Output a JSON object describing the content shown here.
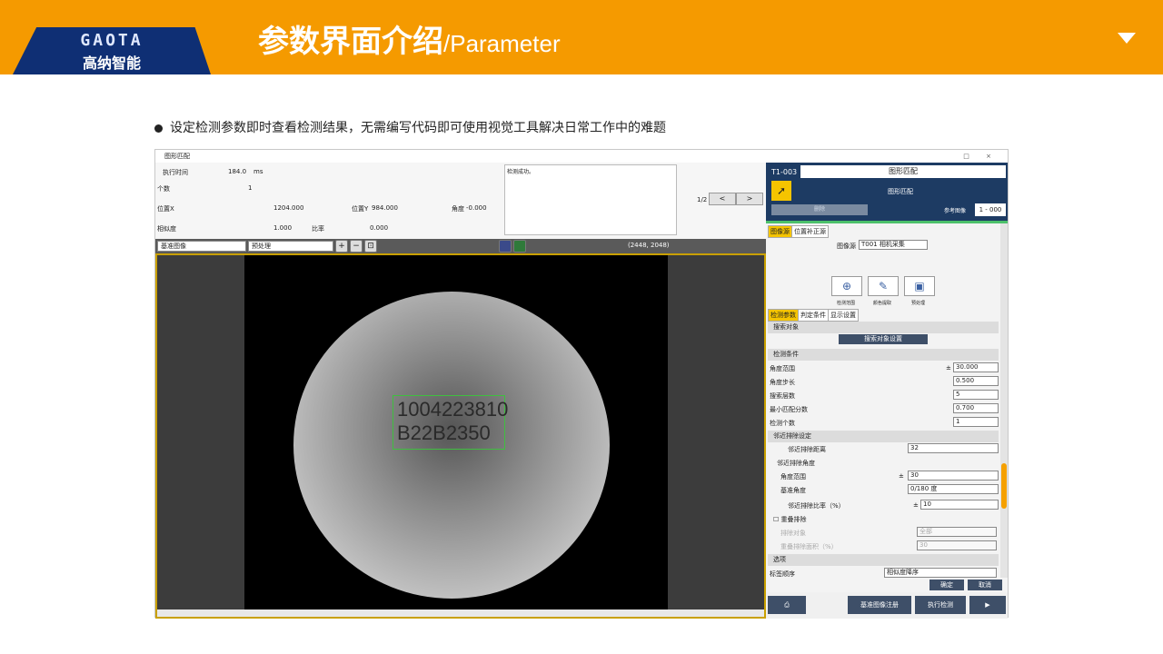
{
  "logo": {
    "en": "GAOTA",
    "cn": "高纳智能"
  },
  "slide": {
    "title_cn": "参数界面介绍",
    "title_en": "/Parameter",
    "bullet": "设定检测参数即时查看检测结果，无需编写代码即可使用视觉工具解决日常工作中的难题"
  },
  "window": {
    "title": "图形匹配",
    "controls": "□ ×"
  },
  "info": {
    "exec_time_label": "执行时间",
    "exec_time_value": "184.0",
    "exec_time_unit": "ms",
    "count_label": "个数",
    "count_value": "1",
    "pos_x_label": "位置X",
    "pos_x_value": "1204.000",
    "pos_y_label": "位置Y",
    "pos_y_value": "984.000",
    "angle_label": "角度",
    "angle_value": "-0.000",
    "similarity_label": "相似度",
    "similarity_value": "1.000",
    "ratio_label": "比率",
    "ratio_value": "0.000",
    "result_label": "检测成功。",
    "pager": "1/2",
    "prev": "<",
    "next": ">"
  },
  "toolbar": {
    "image_select": "基准图像",
    "preproc_select": "预处理",
    "zoom_in": "+",
    "zoom_out": "−",
    "zoom_fit": "⊡",
    "image_size": "(2448, 2048)"
  },
  "image": {
    "line1": "1004223810",
    "line2": "B22B2350"
  },
  "tool": {
    "code": "T1-003",
    "name": "图形匹配",
    "sub": "图形匹配",
    "delete": "删除",
    "ref_label": "参考图像",
    "ref_value": "1 - 000"
  },
  "panel": {
    "src_tabs": [
      "图像源",
      "位置补正源"
    ],
    "src_label": "图像源",
    "src_value": "T001 相机采集",
    "icons": [
      {
        "label": "检测范围"
      },
      {
        "label": "颜色提取"
      },
      {
        "label": "预处理"
      }
    ],
    "param_tabs": [
      "检测参数",
      "判定条件",
      "显示设置"
    ],
    "search_obj": "搜索对象",
    "search_btn": "搜索对象设置",
    "cond_title": "检测条件",
    "angle_range": "角度范围",
    "angle_range_val": "30.000",
    "angle_step": "角度步长",
    "angle_step_val": "0.500",
    "search_layers": "搜索层数",
    "search_layers_val": "5",
    "min_score": "最小匹配分数",
    "min_score_val": "0.700",
    "det_count": "检测个数",
    "det_count_val": "1",
    "nbr_title": "邻近排除设定",
    "nbr_dist": "邻近排除距离",
    "nbr_dist_val": "32",
    "nbr_angle": "邻近排除角度",
    "ang_range": "角度范围",
    "ang_range_val": "30",
    "base_angle": "基准角度",
    "base_angle_val": "0/180 度",
    "nbr_ratio": "邻近排除比率（%）",
    "nbr_ratio_val": "10",
    "overlap": "重叠排除",
    "exclude_obj": "排除对象",
    "exclude_obj_val": "全部",
    "overlap_area": "重叠排除面积（%）",
    "overlap_area_val": "30",
    "options": "选项",
    "sort": "标签顺序",
    "sort_val": "相似度降序",
    "pm": "±",
    "ok": "确定",
    "cancel": "取消"
  },
  "bottom": {
    "register": "基准图像注册",
    "exec": "执行检测"
  }
}
